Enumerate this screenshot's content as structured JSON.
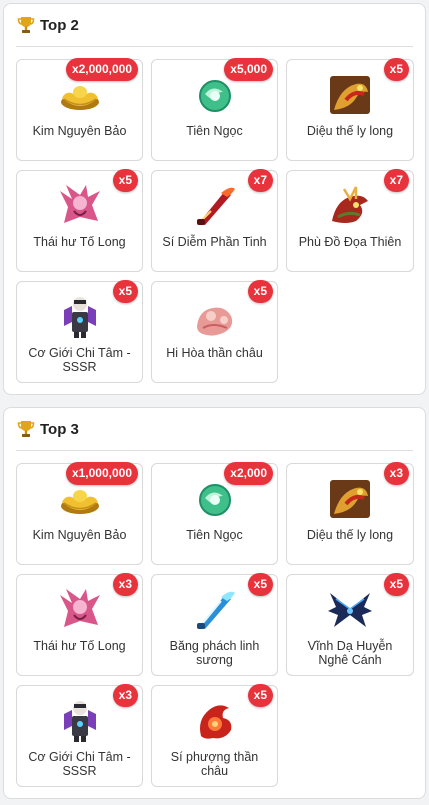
{
  "sections": [
    {
      "title": "Top 2",
      "items": [
        {
          "name": "Kim Nguyên Bảo",
          "qty": "x2,000,000",
          "icon": "gold-ingot-icon"
        },
        {
          "name": "Tiên Ngọc",
          "qty": "x5,000",
          "icon": "jade-orb-icon"
        },
        {
          "name": "Diệu thế ly long",
          "qty": "x5",
          "icon": "dragon-mount-icon"
        },
        {
          "name": "Thái hư Tố Long",
          "qty": "x5",
          "icon": "pink-dragon-icon"
        },
        {
          "name": "Sí Diễm Phần Tinh",
          "qty": "x7",
          "icon": "flame-blade-icon"
        },
        {
          "name": "Phù Đồ Đọa Thiên",
          "qty": "x7",
          "icon": "red-dragon-icon"
        },
        {
          "name": "Cơ Giới Chi Tâm - SSSR",
          "qty": "x5",
          "icon": "mech-armor-icon"
        },
        {
          "name": "Hi Hòa thần châu",
          "qty": "x5",
          "icon": "pink-spirit-icon"
        }
      ]
    },
    {
      "title": "Top 3",
      "items": [
        {
          "name": "Kim Nguyên Bảo",
          "qty": "x1,000,000",
          "icon": "gold-ingot-icon"
        },
        {
          "name": "Tiên Ngọc",
          "qty": "x2,000",
          "icon": "jade-orb-icon"
        },
        {
          "name": "Diệu thế ly long",
          "qty": "x3",
          "icon": "dragon-mount-icon"
        },
        {
          "name": "Thái hư Tố Long",
          "qty": "x3",
          "icon": "pink-dragon-icon"
        },
        {
          "name": "Băng phách linh sương",
          "qty": "x5",
          "icon": "ice-blade-icon"
        },
        {
          "name": "Vĩnh Dạ Huyễn Nghê Cánh",
          "qty": "x5",
          "icon": "dark-wings-icon"
        },
        {
          "name": "Cơ Giới Chi Tâm - SSSR",
          "qty": "x3",
          "icon": "mech-armor-icon"
        },
        {
          "name": "Sí phượng thần châu",
          "qty": "x5",
          "icon": "fire-phoenix-icon"
        }
      ]
    }
  ]
}
